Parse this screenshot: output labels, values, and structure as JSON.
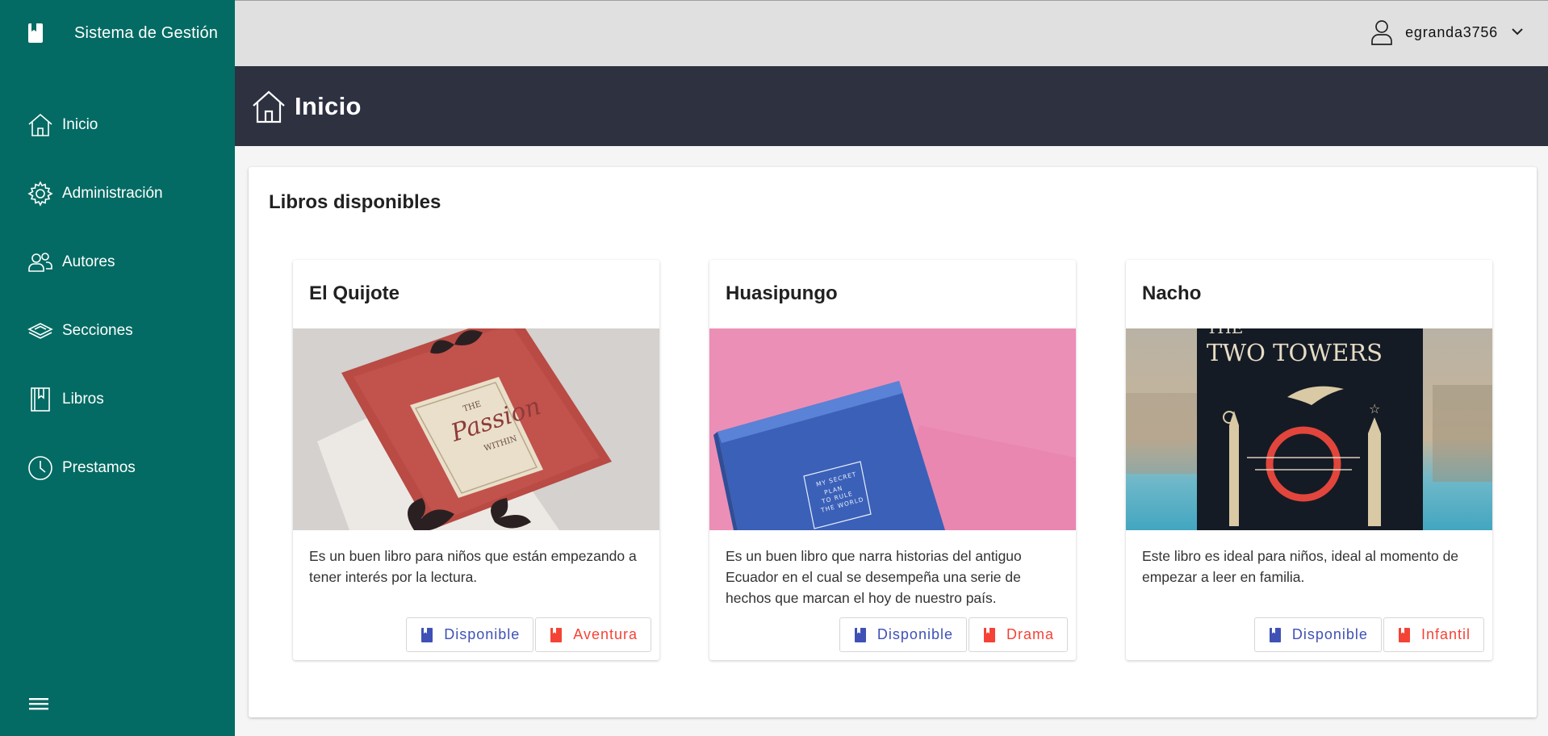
{
  "app": {
    "title": "Sistema de Gestión"
  },
  "sidebar": {
    "items": [
      {
        "label": "Inicio",
        "icon": "home-icon"
      },
      {
        "label": "Administración",
        "icon": "gear-icon"
      },
      {
        "label": "Autores",
        "icon": "users-icon"
      },
      {
        "label": "Secciones",
        "icon": "layers-icon"
      },
      {
        "label": "Libros",
        "icon": "book-icon"
      },
      {
        "label": "Prestamos",
        "icon": "clock-icon"
      }
    ]
  },
  "topbar": {
    "username": "egranda3756"
  },
  "header": {
    "title": "Inicio"
  },
  "main": {
    "section_title": "Libros disponibles",
    "books": [
      {
        "title": "El Quijote",
        "description": "Es un buen libro para niños que están empezando a tener interés por la lectura.",
        "status": "Disponible",
        "genre": "Aventura",
        "cover_text": [
          "THE",
          "Passion",
          "WITHIN"
        ]
      },
      {
        "title": "Huasipungo",
        "description": "Es un buen libro que narra historias del antiguo Ecuador en el cual se desempeña una serie de hechos que marcan el hoy de nuestro país.",
        "status": "Disponible",
        "genre": "Drama",
        "cover_text": [
          "MY SECRET",
          "PLAN",
          "TO RULE",
          "THE WORLD"
        ]
      },
      {
        "title": "Nacho",
        "description": "Este libro es ideal para niños, ideal al momento de empezar a leer en familia.",
        "status": "Disponible",
        "genre": "Infantil",
        "cover_text": [
          "THE",
          "TWO TOWERS"
        ]
      }
    ]
  },
  "colors": {
    "sidebar": "#036b63",
    "header": "#2d3140",
    "status_tag": "#3f51b5",
    "genre_tag": "#f44336"
  }
}
